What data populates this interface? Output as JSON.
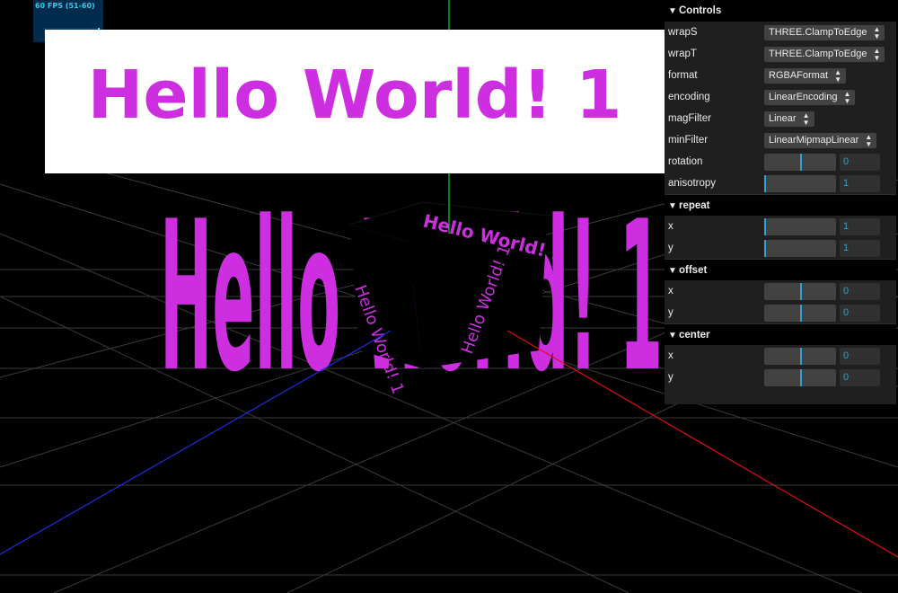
{
  "stats": {
    "fps_text": "60 FPS (51-60)"
  },
  "banner": {
    "text": "Hello World! 1",
    "color": "#cc2ee0"
  },
  "scene": {
    "texture_text": "Hello World! 1",
    "axes_colors": {
      "x": "#e01010",
      "y": "#10d010",
      "z": "#1a2ee0"
    }
  },
  "gui": {
    "title": "Controls",
    "rows": [
      {
        "label": "wrapS",
        "type": "select",
        "value": "THREE.ClampToEdge"
      },
      {
        "label": "wrapT",
        "type": "select",
        "value": "THREE.ClampToEdge"
      },
      {
        "label": "format",
        "type": "select",
        "value": "RGBAFormat"
      },
      {
        "label": "encoding",
        "type": "select",
        "value": "LinearEncoding"
      },
      {
        "label": "magFilter",
        "type": "select",
        "value": "Linear"
      },
      {
        "label": "minFilter",
        "type": "select",
        "value": "LinearMipmapLinear"
      },
      {
        "label": "rotation",
        "type": "slider",
        "value": "0",
        "fraction": 0.5
      },
      {
        "label": "anisotropy",
        "type": "slider",
        "value": "1",
        "fraction": 0.0
      }
    ],
    "folders": [
      {
        "title": "repeat",
        "rows": [
          {
            "label": "x",
            "value": "1",
            "fraction": 0.0
          },
          {
            "label": "y",
            "value": "1",
            "fraction": 0.0
          }
        ]
      },
      {
        "title": "offset",
        "rows": [
          {
            "label": "x",
            "value": "0",
            "fraction": 0.5
          },
          {
            "label": "y",
            "value": "0",
            "fraction": 0.5
          }
        ]
      },
      {
        "title": "center",
        "rows": [
          {
            "label": "x",
            "value": "0",
            "fraction": 0.5
          },
          {
            "label": "y",
            "value": "0",
            "fraction": 0.5
          }
        ]
      }
    ]
  }
}
